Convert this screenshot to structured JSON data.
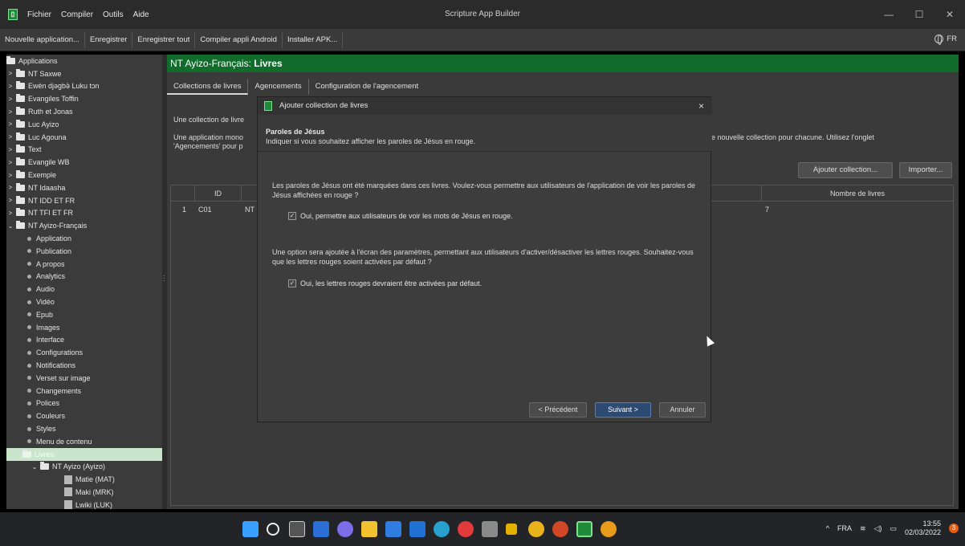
{
  "window": {
    "title": "Scripture App Builder",
    "menu": [
      "Fichier",
      "Compiler",
      "Outils",
      "Aide"
    ],
    "controls": [
      "minimize",
      "maximize",
      "close"
    ]
  },
  "toolbar": {
    "buttons": [
      "Nouvelle application...",
      "Enregistrer",
      "Enregistrer tout",
      "Compiler appli Android",
      "Installer APK..."
    ],
    "language": "FR"
  },
  "sidebar": {
    "root": "Applications",
    "items": [
      {
        "label": "NT Saxwe",
        "type": "folder"
      },
      {
        "label": "Ewèn djǝgbǝ̀ Luku tɔn",
        "type": "folder"
      },
      {
        "label": "Evangiles Toffin",
        "type": "folder"
      },
      {
        "label": "Ruth et Jonas",
        "type": "folder"
      },
      {
        "label": "Luc Ayizo",
        "type": "folder"
      },
      {
        "label": "Luc Agouna",
        "type": "folder"
      },
      {
        "label": "Text",
        "type": "folder"
      },
      {
        "label": "Evangile WB",
        "type": "folder"
      },
      {
        "label": "Exemple",
        "type": "folder"
      },
      {
        "label": "NT Idaasha",
        "type": "folder"
      },
      {
        "label": "NT IDD ET FR",
        "type": "folder"
      },
      {
        "label": "NT TFI ET FR",
        "type": "folder"
      },
      {
        "label": "NT Ayizo-Français",
        "type": "folder-open"
      }
    ],
    "sub_items": [
      "Application",
      "Publication",
      "A propos",
      "Analytics",
      "Audio",
      "Vidéo",
      "Epub",
      "Images",
      "Interface",
      "Configurations",
      "Notifications",
      "Verset sur image",
      "Changements",
      "Polices",
      "Couleurs",
      "Styles",
      "Menu de contenu"
    ],
    "selected_item": "Livres",
    "collection": "NT Ayizo (Ayizo)",
    "books": [
      "Matie (MAT)",
      "Maki (MRK)",
      "Lwiki (LUK)"
    ]
  },
  "content": {
    "header_name": "NT Ayizo-Français:",
    "header_section": "Livres",
    "tabs": [
      "Collections de livres",
      "Agencements",
      "Configuration de l'agencement"
    ],
    "desc_line1": "Une collection de livre",
    "desc_line2a": "Une application mono",
    "desc_line2b": "'Agencements' pour p",
    "desc_right": "e nouvelle collection pour chacune. Utilisez l'onglet",
    "add_collection_button": "Ajouter collection...",
    "import_button": "Importer...",
    "table": {
      "headers": [
        "ID",
        "Nombre de livres"
      ],
      "rows": [
        {
          "num": "1",
          "id": "C01",
          "name": "NT",
          "count": "7"
        }
      ]
    }
  },
  "dialog": {
    "title": "Ajouter collection de livres",
    "close": "×",
    "header_title": "Paroles de Jésus",
    "header_subtitle": "Indiquer si vous souhaitez afficher les paroles de Jésus en rouge.",
    "text1": "Les paroles de Jésus ont été marquées dans ces livres. Voulez-vous permettre aux utilisateurs de l'application de voir les paroles de Jésus affichées en rouge ?",
    "checkbox1": "Oui, permettre aux utilisateurs de voir les mots de Jésus en rouge.",
    "checkbox1_checked": true,
    "text2": "Une option sera ajoutée à l'écran des paramètres, permettant aux utilisateurs d'activer/désactiver les lettres rouges. Souhaitez-vous que les lettres rouges soient activées par défaut ?",
    "checkbox2": "Oui, les lettres rouges devraient être activées par défaut.",
    "checkbox2_checked": true,
    "btn_prev": "< Précédent",
    "btn_next": "Suivant >",
    "btn_cancel": "Annuler"
  },
  "taskbar": {
    "tray_lang": "FRA",
    "time": "13:55",
    "date": "02/03/2022",
    "notifications": "3"
  }
}
